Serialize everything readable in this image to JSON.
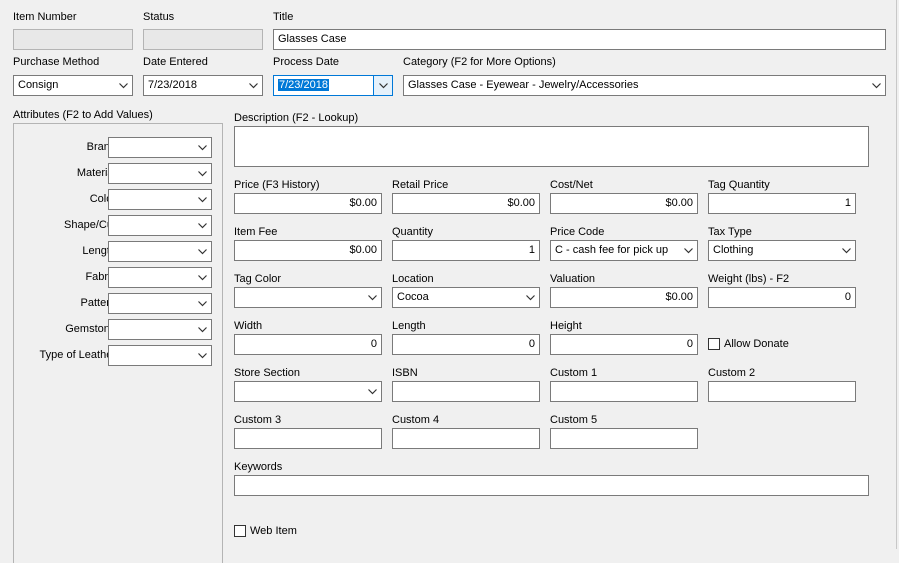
{
  "labels": {
    "item_number": "Item Number",
    "status": "Status",
    "title": "Title",
    "purchase_method": "Purchase Method",
    "date_entered": "Date Entered",
    "process_date": "Process Date",
    "category": "Category (F2 for More Options)",
    "attributes": "Attributes (F2 to Add Values)",
    "description": "Description (F2 - Lookup)",
    "price": "Price (F3 History)",
    "retail_price": "Retail Price",
    "cost_net": "Cost/Net",
    "tag_quantity": "Tag Quantity",
    "item_fee": "Item Fee",
    "quantity": "Quantity",
    "price_code": "Price Code",
    "tax_type": "Tax Type",
    "tag_color": "Tag Color",
    "location": "Location",
    "valuation": "Valuation",
    "weight": "Weight (lbs) - F2",
    "width": "Width",
    "length": "Length",
    "height": "Height",
    "allow_donate": "Allow Donate",
    "store_section": "Store Section",
    "isbn": "ISBN",
    "custom1": "Custom 1",
    "custom2": "Custom 2",
    "custom3": "Custom 3",
    "custom4": "Custom 4",
    "custom5": "Custom 5",
    "keywords": "Keywords",
    "web_item": "Web Item"
  },
  "values": {
    "item_number": "",
    "status": "",
    "title": "Glasses Case",
    "purchase_method": "Consign",
    "date_entered": "7/23/2018",
    "process_date": "7/23/2018",
    "category": "Glasses Case - Eyewear - Jewelry/Accessories",
    "description": "",
    "price": "$0.00",
    "retail_price": "$0.00",
    "cost_net": "$0.00",
    "tag_quantity": "1",
    "item_fee": "$0.00",
    "quantity": "1",
    "price_code": "C - cash fee for pick up",
    "tax_type": "Clothing",
    "tag_color": "",
    "location": "Cocoa",
    "valuation": "$0.00",
    "weight": "0",
    "width": "0",
    "length": "0",
    "height": "0",
    "allow_donate": false,
    "store_section": "",
    "isbn": "",
    "custom1": "",
    "custom2": "",
    "custom3": "",
    "custom4": "",
    "custom5": "",
    "keywords": "",
    "web_item": false
  },
  "attributes": [
    {
      "label": "Brand",
      "value": ""
    },
    {
      "label": "Material",
      "value": ""
    },
    {
      "label": "Color",
      "value": ""
    },
    {
      "label": "Shape/Cut",
      "value": ""
    },
    {
      "label": "Length",
      "value": ""
    },
    {
      "label": "Fabric",
      "value": ""
    },
    {
      "label": "Pattern",
      "value": ""
    },
    {
      "label": "Gemstone",
      "value": ""
    },
    {
      "label": "Type of Leather",
      "value": ""
    }
  ],
  "icons": {
    "dropdown": "chevron-down-icon",
    "checkbox": "checkbox-unchecked-icon"
  },
  "colors": {
    "focus_accent": "#0078d7",
    "window_bg": "#f0f0f0"
  }
}
